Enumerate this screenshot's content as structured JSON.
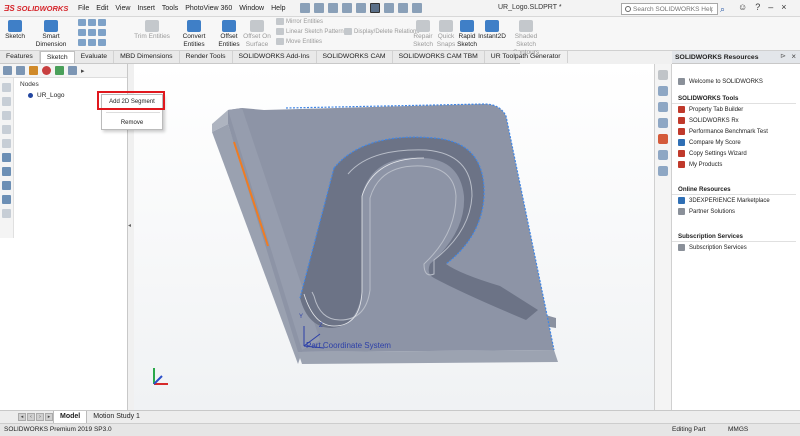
{
  "app": {
    "logo_text": "SOLIDWORKS",
    "doc_title": "UR_Logo.SLDPRT *",
    "menu": [
      "File",
      "Edit",
      "View",
      "Insert",
      "Tools",
      "PhotoView 360",
      "Window",
      "Help"
    ],
    "search_placeholder": "Search SOLIDWORKS Help"
  },
  "ribbon": {
    "sketch": "Sketch",
    "smart_dimension": "Smart Dimension",
    "trim_entities": "Trim Entities",
    "convert_entities": "Convert Entities",
    "offset_entities": "Offset Entities",
    "offset_on_surface": "Offset On Surface",
    "mirror_entities": "Mirror Entities",
    "linear_sketch_pattern": "Linear Sketch Pattern",
    "move_entities": "Move Entities",
    "display_delete_relations": "Display/Delete Relations",
    "repair_sketch": "Repair Sketch",
    "quick_snaps": "Quick Snaps",
    "rapid_sketch": "Rapid Sketch",
    "instant2d": "Instant2D",
    "shaded_sketch_contours": "Shaded Sketch Contours"
  },
  "tabs": [
    "Features",
    "Sketch",
    "Evaluate",
    "MBD Dimensions",
    "Render Tools",
    "SOLIDWORKS Add-Ins",
    "SOLIDWORKS CAM",
    "SOLIDWORKS CAM TBM",
    "UR Toolpath Generator"
  ],
  "tree": {
    "nodes_label": "Nodes",
    "node": "UR_Logo"
  },
  "context_menu": {
    "add": "Add 2D Segment",
    "remove": "Remove"
  },
  "viewport": {
    "csys_label": "Part Coordinate System",
    "axis_y": "Y",
    "axis_z": "Z"
  },
  "resources": {
    "title": "SOLIDWORKS Resources",
    "welcome": "Welcome to SOLIDWORKS",
    "tools_header": "SOLIDWORKS Tools",
    "tools": [
      "Property Tab Builder",
      "SOLIDWORKS Rx",
      "Performance Benchmark Test",
      "Compare My Score",
      "Copy Settings Wizard",
      "My Products"
    ],
    "online_header": "Online Resources",
    "online": [
      "3DEXPERIENCE Marketplace",
      "Partner Solutions"
    ],
    "subscription_header": "Subscription Services",
    "subscription": [
      "Subscription Services"
    ]
  },
  "bottom_tabs": [
    "Model",
    "Motion Study 1"
  ],
  "status": {
    "left": "SOLIDWORKS Premium 2019 SP3.0",
    "mode": "Editing Part",
    "units": "MMGS"
  },
  "colors": {
    "accent_red": "#e0181e",
    "part_face": "#8d94a6",
    "edge_highlight": "#3f86e6",
    "selected_edge": "#f07c22"
  }
}
